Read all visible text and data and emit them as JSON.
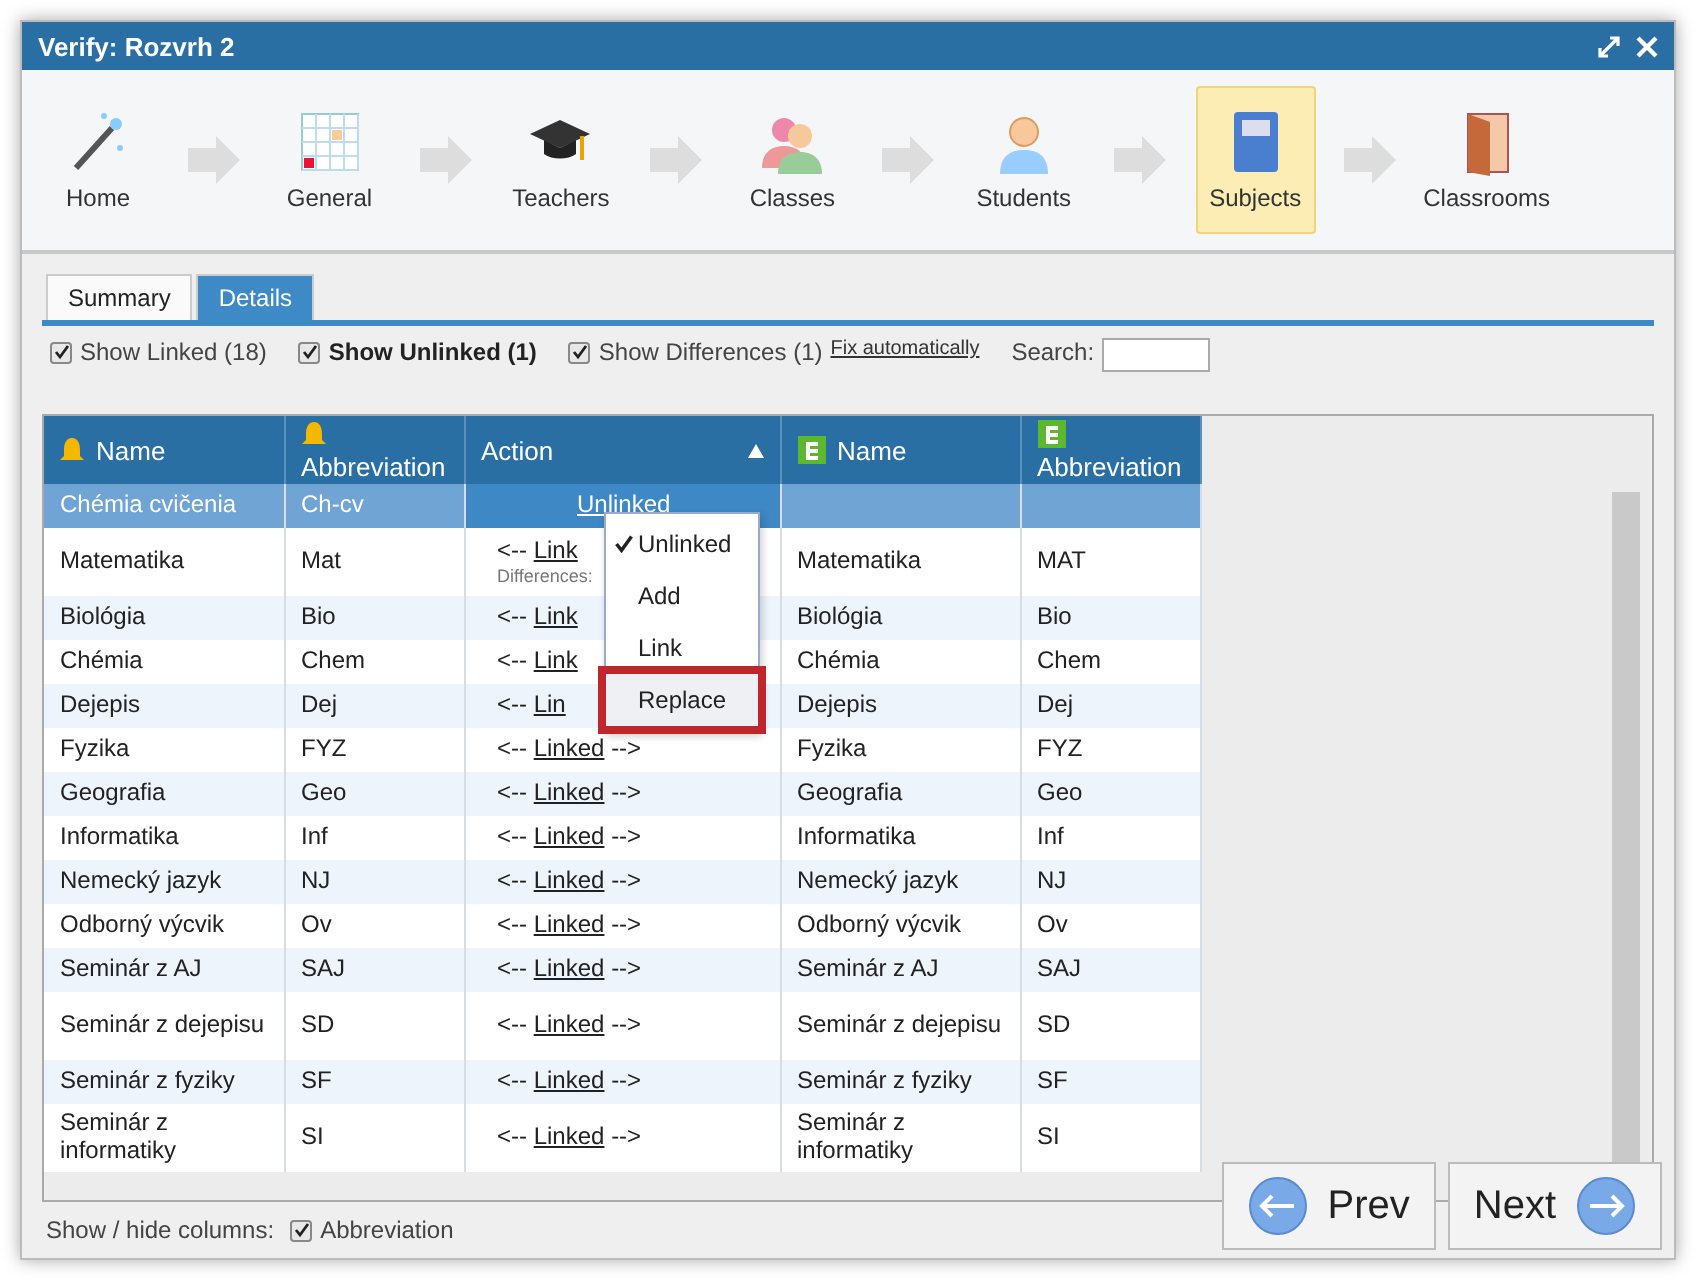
{
  "window": {
    "title": "Verify: Rozvrh 2"
  },
  "steps": [
    {
      "label": "Home",
      "selected": false
    },
    {
      "label": "General",
      "selected": false
    },
    {
      "label": "Teachers",
      "selected": false
    },
    {
      "label": "Classes",
      "selected": false
    },
    {
      "label": "Students",
      "selected": false
    },
    {
      "label": "Subjects",
      "selected": true
    },
    {
      "label": "Classrooms",
      "selected": false
    }
  ],
  "tabs": [
    {
      "label": "Summary",
      "selected": false
    },
    {
      "label": "Details",
      "selected": true
    }
  ],
  "filters": [
    {
      "label": "Show Linked (18)",
      "checked": true,
      "bold": false
    },
    {
      "label": "Show Unlinked (1)",
      "checked": true,
      "bold": true
    },
    {
      "label": "Show Differences (1)",
      "checked": true,
      "bold": false
    }
  ],
  "fix_link": "Fix automatically",
  "search": {
    "label": "Search:"
  },
  "table": {
    "columns": [
      {
        "label": "Name"
      },
      {
        "label": "Abbreviation"
      },
      {
        "label": "Action"
      },
      {
        "label": "Name"
      },
      {
        "label": "Abbreviation"
      }
    ],
    "rows": [
      {
        "name": "Chémia cvičenia",
        "abbr": "Ch-cv",
        "action": {
          "link": "Unlinked"
        },
        "name2": "",
        "abbr2": "",
        "selected": true
      },
      {
        "name": "Matematika",
        "abbr": "Mat",
        "action": {
          "prefix": "<--",
          "link": "Link"
        },
        "note": "Differences:",
        "name2": "Matematika",
        "abbr2": "MAT",
        "selected": false
      },
      {
        "name": "Biológia",
        "abbr": "Bio",
        "action": {
          "prefix": "<--",
          "link": "Link"
        },
        "name2": "Biológia",
        "abbr2": "Bio",
        "selected": false
      },
      {
        "name": "Chémia",
        "abbr": "Chem",
        "action": {
          "prefix": "<--",
          "link": "Link"
        },
        "name2": "Chémia",
        "abbr2": "Chem",
        "selected": false
      },
      {
        "name": "Dejepis",
        "abbr": "Dej",
        "action": {
          "prefix": "<--",
          "link": "Lin"
        },
        "name2": "Dejepis",
        "abbr2": "Dej",
        "selected": false
      },
      {
        "name": "Fyzika",
        "abbr": "FYZ",
        "action": {
          "prefix": "<--",
          "link": "Linked",
          "suffix": "-->"
        },
        "name2": "Fyzika",
        "abbr2": "FYZ",
        "selected": false
      },
      {
        "name": "Geografia",
        "abbr": "Geo",
        "action": {
          "prefix": "<--",
          "link": "Linked",
          "suffix": "-->"
        },
        "name2": "Geografia",
        "abbr2": "Geo",
        "selected": false
      },
      {
        "name": "Informatika",
        "abbr": "Inf",
        "action": {
          "prefix": "<--",
          "link": "Linked",
          "suffix": "-->"
        },
        "name2": "Informatika",
        "abbr2": "Inf",
        "selected": false
      },
      {
        "name": "Nemecký jazyk",
        "abbr": "NJ",
        "action": {
          "prefix": "<--",
          "link": "Linked",
          "suffix": "-->"
        },
        "name2": "Nemecký jazyk",
        "abbr2": "NJ",
        "selected": false
      },
      {
        "name": "Odborný výcvik",
        "abbr": "Ov",
        "action": {
          "prefix": "<--",
          "link": "Linked",
          "suffix": "-->"
        },
        "name2": "Odborný výcvik",
        "abbr2": "Ov",
        "selected": false
      },
      {
        "name": "Seminár z AJ",
        "abbr": "SAJ",
        "action": {
          "prefix": "<--",
          "link": "Linked",
          "suffix": "-->"
        },
        "name2": "Seminár z AJ",
        "abbr2": "SAJ",
        "selected": false
      },
      {
        "name": "Seminár z dejepisu",
        "abbr": "SD",
        "action": {
          "prefix": "<--",
          "link": "Linked",
          "suffix": "-->"
        },
        "name2": "Seminár z dejepisu",
        "abbr2": "SD",
        "selected": false
      },
      {
        "name": "Seminár z fyziky",
        "abbr": "SF",
        "action": {
          "prefix": "<--",
          "link": "Linked",
          "suffix": "-->"
        },
        "name2": "Seminár z fyziky",
        "abbr2": "SF",
        "selected": false
      },
      {
        "name": "Seminár z informatiky",
        "abbr": "SI",
        "action": {
          "prefix": "<--",
          "link": "Linked",
          "suffix": "-->"
        },
        "name2": "Seminár z informatiky",
        "abbr2": "SI",
        "selected": false
      }
    ]
  },
  "menu": [
    {
      "label": "Unlinked",
      "checked": true,
      "highlighted": false
    },
    {
      "label": "Add",
      "checked": false,
      "highlighted": false
    },
    {
      "label": "Link",
      "checked": false,
      "highlighted": false
    },
    {
      "label": "Replace",
      "checked": false,
      "highlighted": true
    }
  ],
  "columns_toggle": {
    "label": "Show / hide columns:",
    "options": [
      {
        "label": "Abbreviation",
        "checked": true
      }
    ]
  },
  "buttons": [
    {
      "label": "Prev",
      "kind": "prev"
    },
    {
      "label": "Next",
      "kind": "next"
    }
  ]
}
